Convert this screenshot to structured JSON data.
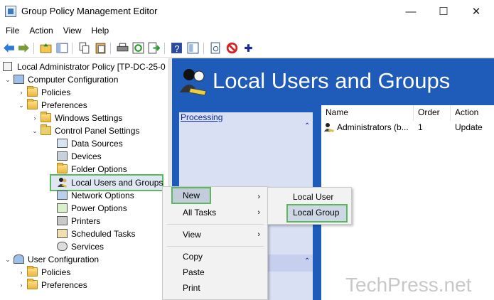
{
  "window": {
    "title": "Group Policy Management Editor",
    "controls": [
      "—",
      "☐",
      "✕"
    ]
  },
  "menubar": [
    "File",
    "Action",
    "View",
    "Help"
  ],
  "tree": {
    "root": "Local Administrator Policy [TP-DC-25-0",
    "computer_config": "Computer Configuration",
    "policies": "Policies",
    "preferences": "Preferences",
    "windows_settings": "Windows Settings",
    "control_panel_settings": "Control Panel Settings",
    "data_sources": "Data Sources",
    "devices": "Devices",
    "folder_options": "Folder Options",
    "local_users_groups": "Local Users and Groups",
    "network_options": "Network Options",
    "power_options": "Power Options",
    "printers": "Printers",
    "scheduled_tasks": "Scheduled Tasks",
    "services": "Services",
    "user_config": "User Configuration",
    "user_policies": "Policies",
    "user_preferences": "Preferences"
  },
  "right": {
    "banner": "Local Users and Groups",
    "processing": "Processing",
    "columns": [
      "Name",
      "Order",
      "Action"
    ],
    "rows": [
      {
        "name": "Administrators (b...",
        "order": "1",
        "action": "Update"
      }
    ]
  },
  "context_menu": {
    "new": "New",
    "all_tasks": "All Tasks",
    "view": "View",
    "copy": "Copy",
    "paste": "Paste",
    "print": "Print"
  },
  "submenu": {
    "local_user": "Local User",
    "local_group": "Local Group"
  },
  "watermark": "TechPress.net",
  "colors": {
    "banner_bg": "#1f5bb8",
    "highlight_border": "#5cb85c"
  }
}
